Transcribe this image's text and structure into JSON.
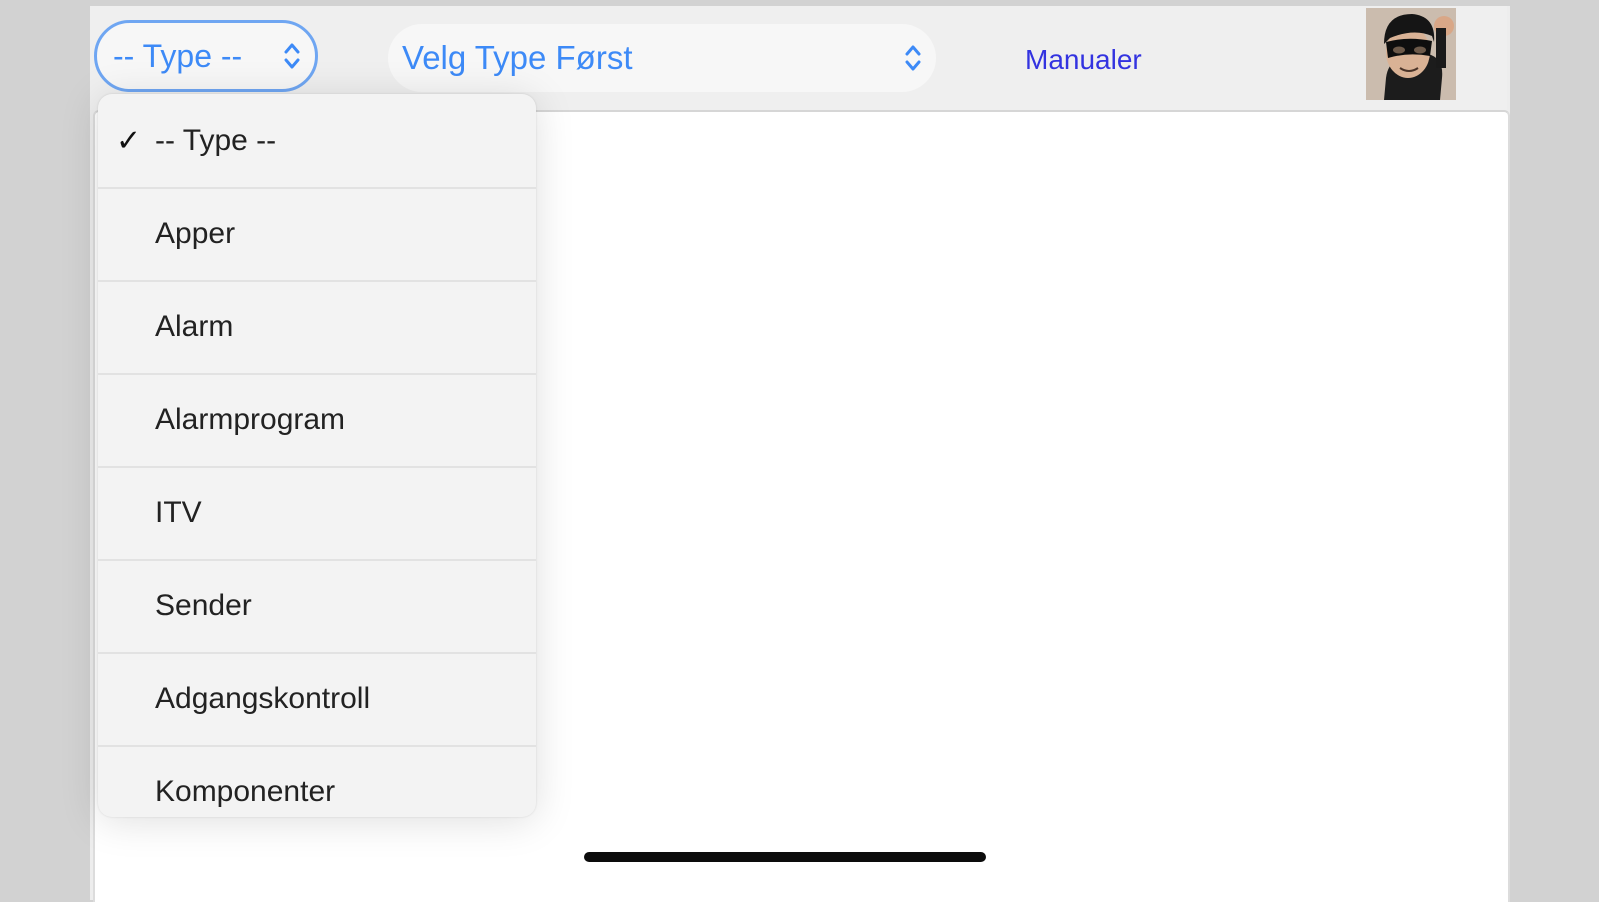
{
  "toolbar": {
    "type_select": {
      "value": "-- Type --"
    },
    "model_select": {
      "value": "Velg Type Først"
    },
    "manuals_link": "Manualer"
  },
  "dropdown": {
    "selected_index": 0,
    "options": [
      "-- Type --",
      "Apper",
      "Alarm",
      "Alarmprogram",
      "ITV",
      "Sender",
      "Adgangskontroll",
      "Komponenter"
    ]
  },
  "colors": {
    "select_text": "#3d8af7",
    "link": "#3333e0",
    "focus_ring": "#6fa6f2"
  }
}
